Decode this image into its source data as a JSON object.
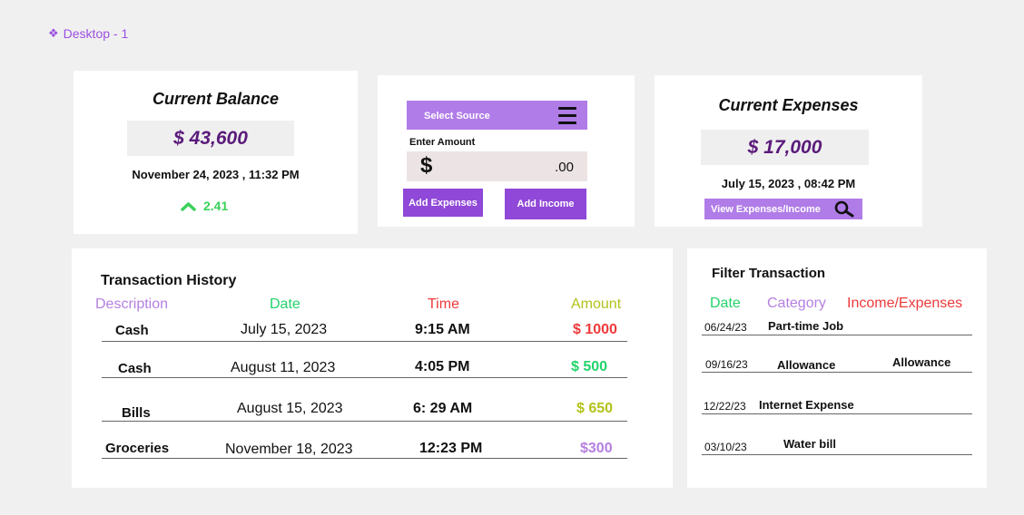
{
  "frame": {
    "label": "Desktop - 1"
  },
  "balance": {
    "title": "Current Balance",
    "amount": "$ 43,600",
    "datetime": "November 24, 2023 ,  11:32 PM",
    "change": "2.41"
  },
  "entry": {
    "select_label": "Select Source",
    "enter_label": "Enter Amount",
    "currency_symbol": "$",
    "cents": ".00",
    "add_expenses": "Add Expenses",
    "add_income": "Add Income"
  },
  "expenses": {
    "title": "Current Expenses",
    "amount": "$ 17,000",
    "datetime": "July 15, 2023 ,  08:42 PM",
    "view_button": "View Expenses/Income"
  },
  "history": {
    "title": "Transaction History",
    "headers": {
      "description": "Description",
      "date": "Date",
      "time": "Time",
      "amount": "Amount"
    },
    "rows": [
      {
        "description": "Cash",
        "date": "July 15, 2023",
        "time": "9:15 AM",
        "amount": "$ 1000",
        "color": "#ee3a3a"
      },
      {
        "description": "Cash",
        "date": "August  11, 2023",
        "time": "4:05 PM",
        "amount": "$ 500",
        "color": "#22d36a"
      },
      {
        "description": "Bills",
        "date": "August 15, 2023",
        "time": "6: 29 AM",
        "amount": "$ 650",
        "color": "#b2c21a"
      },
      {
        "description": "Groceries",
        "date": "November 18, 2023",
        "time": "12:23 PM",
        "amount": "$300",
        "color": "#b57fe0"
      }
    ]
  },
  "filter": {
    "title": "Filter Transaction",
    "headers": {
      "date": "Date",
      "category": "Category",
      "income_expenses": "Income/Expenses"
    },
    "rows": [
      {
        "date": "06/24/23",
        "category": "Part-time Job",
        "income_expenses": ""
      },
      {
        "date": "09/16/23",
        "category": "Allowance",
        "income_expenses": "Allowance"
      },
      {
        "date": "12/22/23",
        "category": "Internet Expense",
        "income_expenses": ""
      },
      {
        "date": "03/10/23",
        "category": "Water bill",
        "income_expenses": ""
      }
    ]
  }
}
